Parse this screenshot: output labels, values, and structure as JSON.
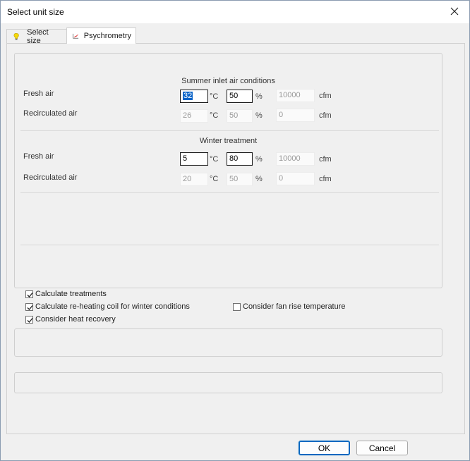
{
  "window": {
    "title": "Select unit size"
  },
  "tabs": [
    {
      "label": "Select size",
      "icon": "bulb-icon"
    },
    {
      "label": "Psychrometry",
      "icon": "psychrometric-chart-icon"
    }
  ],
  "summer": {
    "title": "Summer inlet air conditions",
    "fresh_air": {
      "label": "Fresh air",
      "temp": "32",
      "temp_unit": "°C",
      "humidity": "50",
      "humidity_unit": "%",
      "flow": "10000",
      "flow_unit": "cfm"
    },
    "recirculated_air": {
      "label": "Recirculated air",
      "temp": "26",
      "temp_unit": "°C",
      "humidity": "50",
      "humidity_unit": "%",
      "flow": "0",
      "flow_unit": "cfm"
    }
  },
  "winter": {
    "title": "Winter treatment",
    "fresh_air": {
      "label": "Fresh air",
      "temp": "5",
      "temp_unit": "°C",
      "humidity": "80",
      "humidity_unit": "%",
      "flow": "10000",
      "flow_unit": "cfm"
    },
    "recirculated_air": {
      "label": "Recirculated air",
      "temp": "20",
      "temp_unit": "°C",
      "humidity": "50",
      "humidity_unit": "%",
      "flow": "0",
      "flow_unit": "cfm"
    }
  },
  "options": {
    "calculate_treatments": {
      "label": "Calculate treatments",
      "checked": true
    },
    "reheating_coil": {
      "label": "Calculate re-heating coil for winter conditions",
      "checked": true
    },
    "fan_rise": {
      "label": "Consider fan rise temperature",
      "checked": false
    },
    "heat_recovery": {
      "label": "Consider heat recovery",
      "checked": true
    }
  },
  "buttons": {
    "ok": "OK",
    "cancel": "Cancel"
  },
  "colors": {
    "accent": "#0067c0",
    "selection": "#0a64c8"
  }
}
